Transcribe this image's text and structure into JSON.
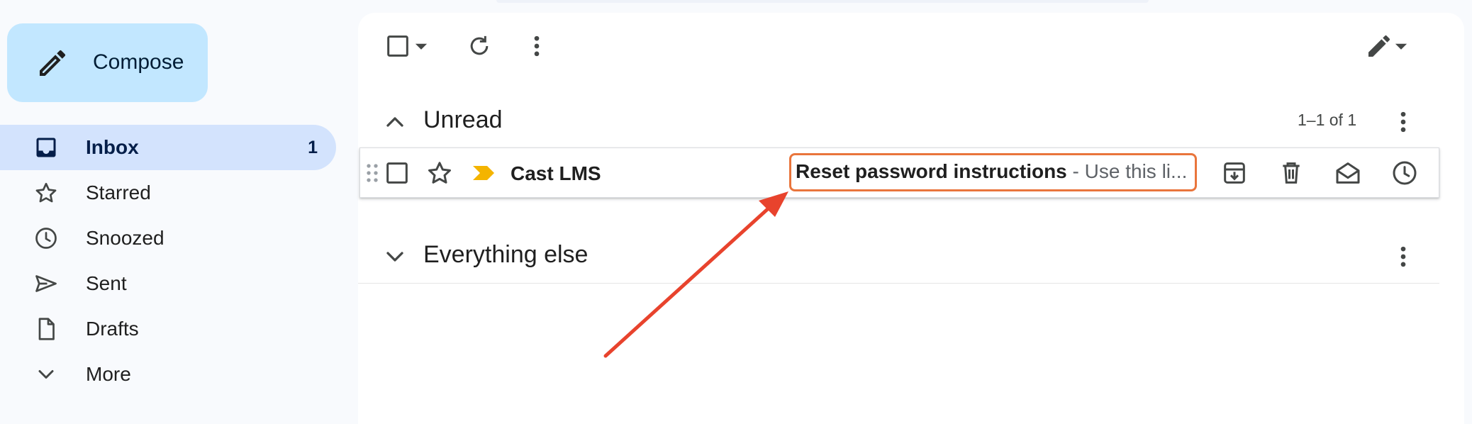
{
  "sidebar": {
    "compose_label": "Compose",
    "items": [
      {
        "label": "Inbox",
        "count": "1",
        "icon": "inbox-icon"
      },
      {
        "label": "Starred",
        "icon": "star-icon"
      },
      {
        "label": "Snoozed",
        "icon": "clock-icon"
      },
      {
        "label": "Sent",
        "icon": "send-icon"
      },
      {
        "label": "Drafts",
        "icon": "draft-icon"
      },
      {
        "label": "More",
        "icon": "chevron-down-icon"
      }
    ]
  },
  "toolbar": {
    "icons": [
      "checkbox-icon",
      "dropdown-caret-icon",
      "refresh-icon",
      "more-vert-icon",
      "pencil-icon"
    ]
  },
  "sections": [
    {
      "title": "Unread",
      "count": "1–1 of 1"
    },
    {
      "title": "Everything else"
    }
  ],
  "email_row": {
    "sender": "Cast LMS",
    "subject": "Reset password instructions",
    "snippet": " - Use this li..."
  },
  "colors": {
    "accent": "#c2e7ff",
    "active_nav": "#d3e3fd",
    "highlight_box": "#e9753c",
    "annotation_arrow": "#e8432d",
    "important_marker": "#f4b400"
  }
}
